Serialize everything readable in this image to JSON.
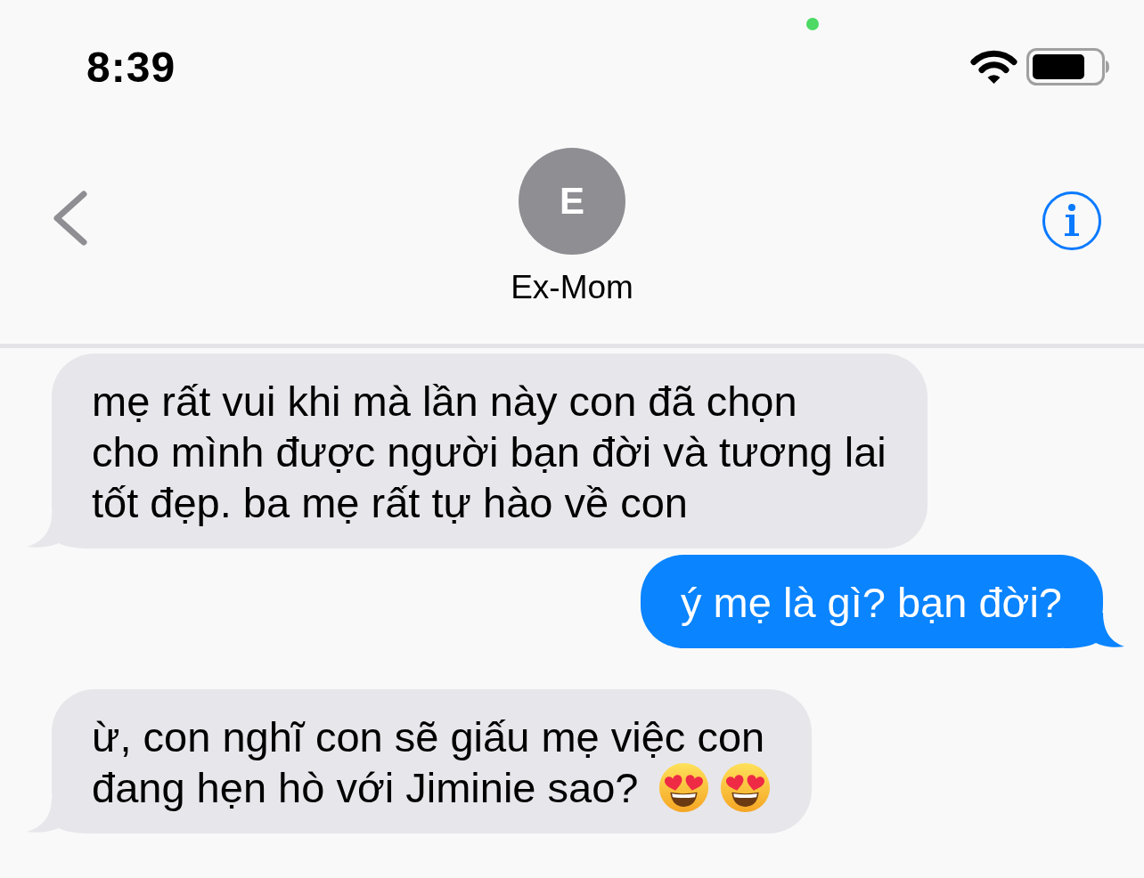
{
  "status_bar": {
    "time": "8:39",
    "privacy_indicator": true
  },
  "header": {
    "avatar_initial": "E",
    "contact_name": "Ex-Mom"
  },
  "messages": [
    {
      "kind": "incoming",
      "lines": [
        "mẹ rất vui khi mà lần này con đã chọn",
        "cho mình được người bạn đời và tương lai",
        "tốt đẹp. ba mẹ rất tự hào về con"
      ]
    },
    {
      "kind": "outgoing",
      "lines": [
        "ý mẹ là gì? bạn đời?"
      ]
    },
    {
      "kind": "incoming",
      "lines": [
        "ừ, con nghĩ con sẽ giấu mẹ việc con",
        "đang hẹn hò với Jiminie sao?"
      ],
      "emoji": [
        {
          "kind": "heart_eyes"
        },
        {
          "kind": "heart_eyes"
        }
      ]
    }
  ]
}
